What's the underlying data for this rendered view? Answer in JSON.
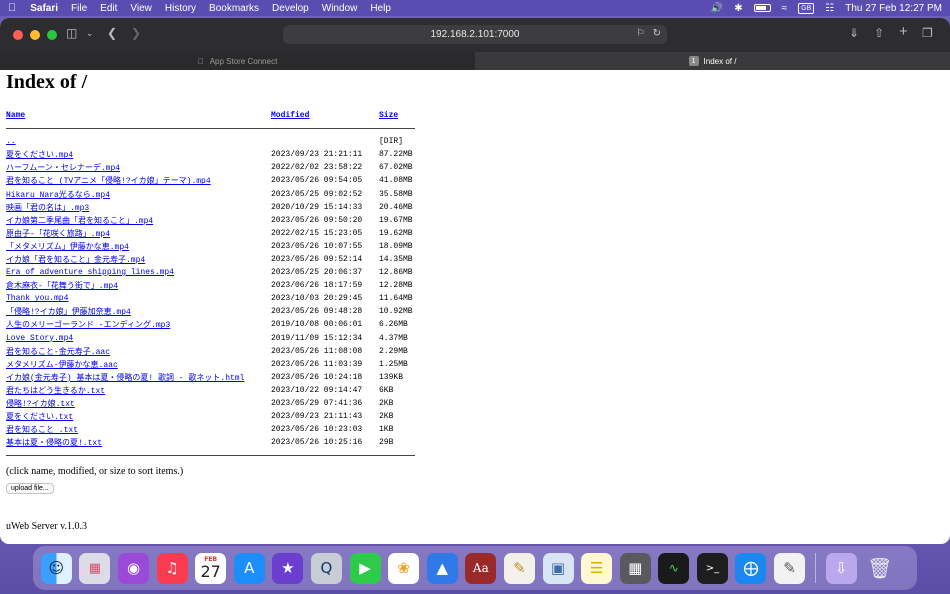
{
  "menubar": {
    "app": "Safari",
    "items": [
      "File",
      "Edit",
      "View",
      "History",
      "Bookmarks",
      "Develop",
      "Window",
      "Help"
    ],
    "input_source": "GB",
    "clock": "Thu 27 Feb  12:27 PM"
  },
  "browser": {
    "url": "192.168.2.101:7000",
    "tabs": [
      {
        "label": "App Store Connect"
      },
      {
        "label": "Index of /",
        "badge": "1"
      }
    ]
  },
  "page": {
    "title": "Index of /",
    "columns": {
      "name": "Name",
      "modified": "Modified",
      "size": "Size"
    },
    "parent": {
      "name": "..",
      "size": "[DIR]"
    },
    "files": [
      {
        "name": "夏をください.mp4",
        "modified": "2023/09/23 21:21:11",
        "size": "87.22MB"
      },
      {
        "name": "ハーフムーン・セレナーデ.mp4",
        "modified": "2022/02/02 23:58:22",
        "size": "67.02MB"
      },
      {
        "name": "君を知ること (TVアニメ「侵略!?イカ娘」テーマ).mp4",
        "modified": "2023/05/26 09:54:05",
        "size": "41.08MB"
      },
      {
        "name": "Hikaru Nara光るなら.mp4",
        "modified": "2023/05/25 09:02:52",
        "size": "35.58MB"
      },
      {
        "name": "映画「君の名は」.mp3",
        "modified": "2020/10/29 15:14:33",
        "size": "20.46MB"
      },
      {
        "name": "イカ娘第二季尾曲「君を知ること」.mp4",
        "modified": "2023/05/26 09:50:20",
        "size": "19.67MB"
      },
      {
        "name": "原由子-「花咲く旅路」.mp4",
        "modified": "2022/02/15 15:23:05",
        "size": "19.62MB"
      },
      {
        "name": "「メタメリズム」伊藤かな恵.mp4",
        "modified": "2023/05/26 10:07:55",
        "size": "18.09MB"
      },
      {
        "name": "イカ娘「君を知ること」金元寿子.mp4",
        "modified": "2023/05/26 09:52:14",
        "size": "14.35MB"
      },
      {
        "name": "Era of adventure shipping lines.mp4",
        "modified": "2023/05/25 20:06:37",
        "size": "12.86MB"
      },
      {
        "name": "倉木麻衣-「花舞う街で」.mp4",
        "modified": "2023/06/26 18:17:59",
        "size": "12.28MB"
      },
      {
        "name": "Thank you.mp4",
        "modified": "2023/10/03 20:29:45",
        "size": "11.64MB"
      },
      {
        "name": "「侵略!?イカ娘」伊藤加奈恵.mp4",
        "modified": "2023/05/26 09:48:28",
        "size": "10.92MB"
      },
      {
        "name": "人生のメリーゴーランド -エンディング.mp3",
        "modified": "2019/10/08 00:06:01",
        "size": "6.26MB"
      },
      {
        "name": "Love Story.mp4",
        "modified": "2019/11/09 15:12:34",
        "size": "4.37MB"
      },
      {
        "name": "君を知ること-金元寿子.aac",
        "modified": "2023/05/26 11:08:08",
        "size": "2.29MB"
      },
      {
        "name": "メタメリズム-伊藤かな恵.aac",
        "modified": "2023/05/26 11:03:39",
        "size": "1.25MB"
      },
      {
        "name": "イカ娘(金元寿子) 基本は夏・侵略の夏! 歌詞 - 歌ネット.html",
        "modified": "2023/05/26 10:24:18",
        "size": "139KB"
      },
      {
        "name": "君たちはどう生きるか.txt",
        "modified": "2023/10/22 09:14:47",
        "size": "6KB"
      },
      {
        "name": "侵略!?イカ娘.txt",
        "modified": "2023/05/29 07:41:36",
        "size": "2KB"
      },
      {
        "name": "夏をください.txt",
        "modified": "2023/09/23 21:11:43",
        "size": "2KB"
      },
      {
        "name": "君を知ること .txt",
        "modified": "2023/05/26 10:23:03",
        "size": "1KB"
      },
      {
        "name": "基本は夏・侵略の夏!.txt",
        "modified": "2023/05/26 10:25:16",
        "size": "29B"
      }
    ],
    "hint": "(click name, modified, or size to sort items.)",
    "upload_label": "upload file...",
    "footer": "uWeb Server v.1.0.3"
  },
  "dock": {
    "icons": [
      "finder-icon",
      "launchpad-icon",
      "podcasts-icon",
      "music-icon",
      "calendar-icon",
      "app-store-icon",
      "imovie-icon",
      "quicktime-icon",
      "facetime-icon",
      "photos-icon",
      "keynote-icon",
      "dictionary-icon",
      "script-editor-icon",
      "preview-icon",
      "notes-icon",
      "calculator-icon",
      "activity-monitor-icon",
      "terminal-icon",
      "safari-icon",
      "textedit-icon",
      "downloads-icon",
      "trash-icon"
    ],
    "calendar": {
      "month": "FEB",
      "day": "27"
    }
  }
}
